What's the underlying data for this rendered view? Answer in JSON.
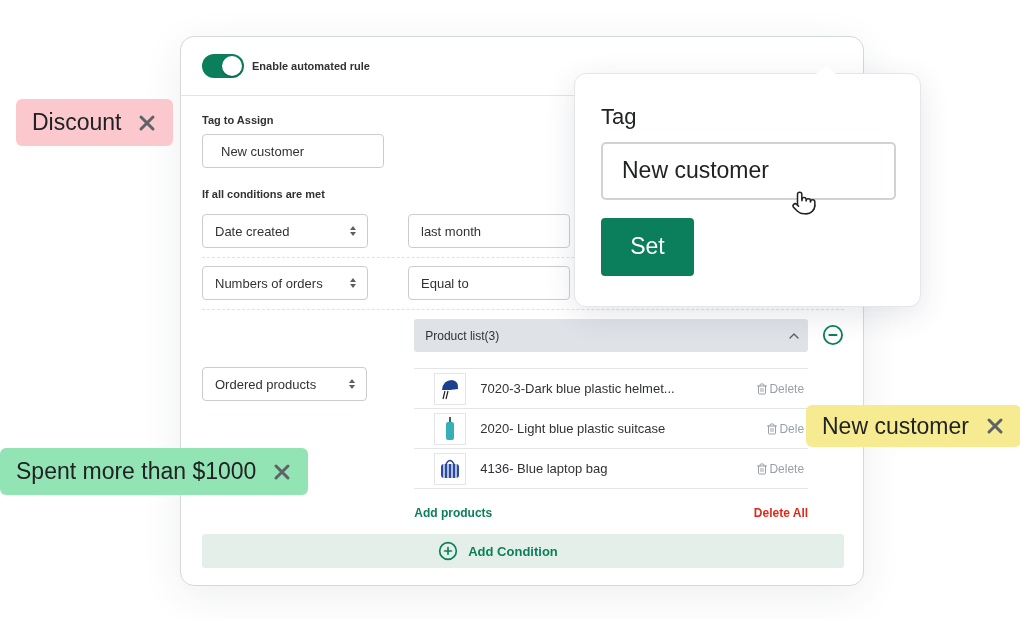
{
  "rule": {
    "label": "Enable automated rule",
    "enabled": true
  },
  "tag_to_assign": {
    "label": "Tag to Assign",
    "value": "New customer"
  },
  "conditions_label": "If all conditions are met",
  "conditions": [
    {
      "kind": "value",
      "field": "Date created",
      "value": "last month"
    },
    {
      "kind": "value",
      "field": "Numbers of orders",
      "value": "Equal to"
    },
    {
      "kind": "products",
      "field": "Ordered products",
      "list_title": "Product list(3)",
      "expanded": true,
      "products": [
        {
          "name": "7020-3-Dark blue plastic helmet...",
          "action": "Delete"
        },
        {
          "name": "2020- Light blue plastic suitcase",
          "action": "Dele"
        },
        {
          "name": "4136- Blue laptop bag",
          "action": "Delete"
        }
      ],
      "add_label": "Add products",
      "delete_all_label": "Delete All"
    }
  ],
  "add_condition": "Add Condition",
  "popover": {
    "label": "Tag",
    "value": "New customer",
    "button": "Set"
  },
  "floating_tags": [
    {
      "label": "Discount",
      "color": "#fbc8ce"
    },
    {
      "label": "New customer",
      "color": "#f7eb91"
    },
    {
      "label": "Spent more than $1000",
      "color": "#93e4b5"
    }
  ]
}
